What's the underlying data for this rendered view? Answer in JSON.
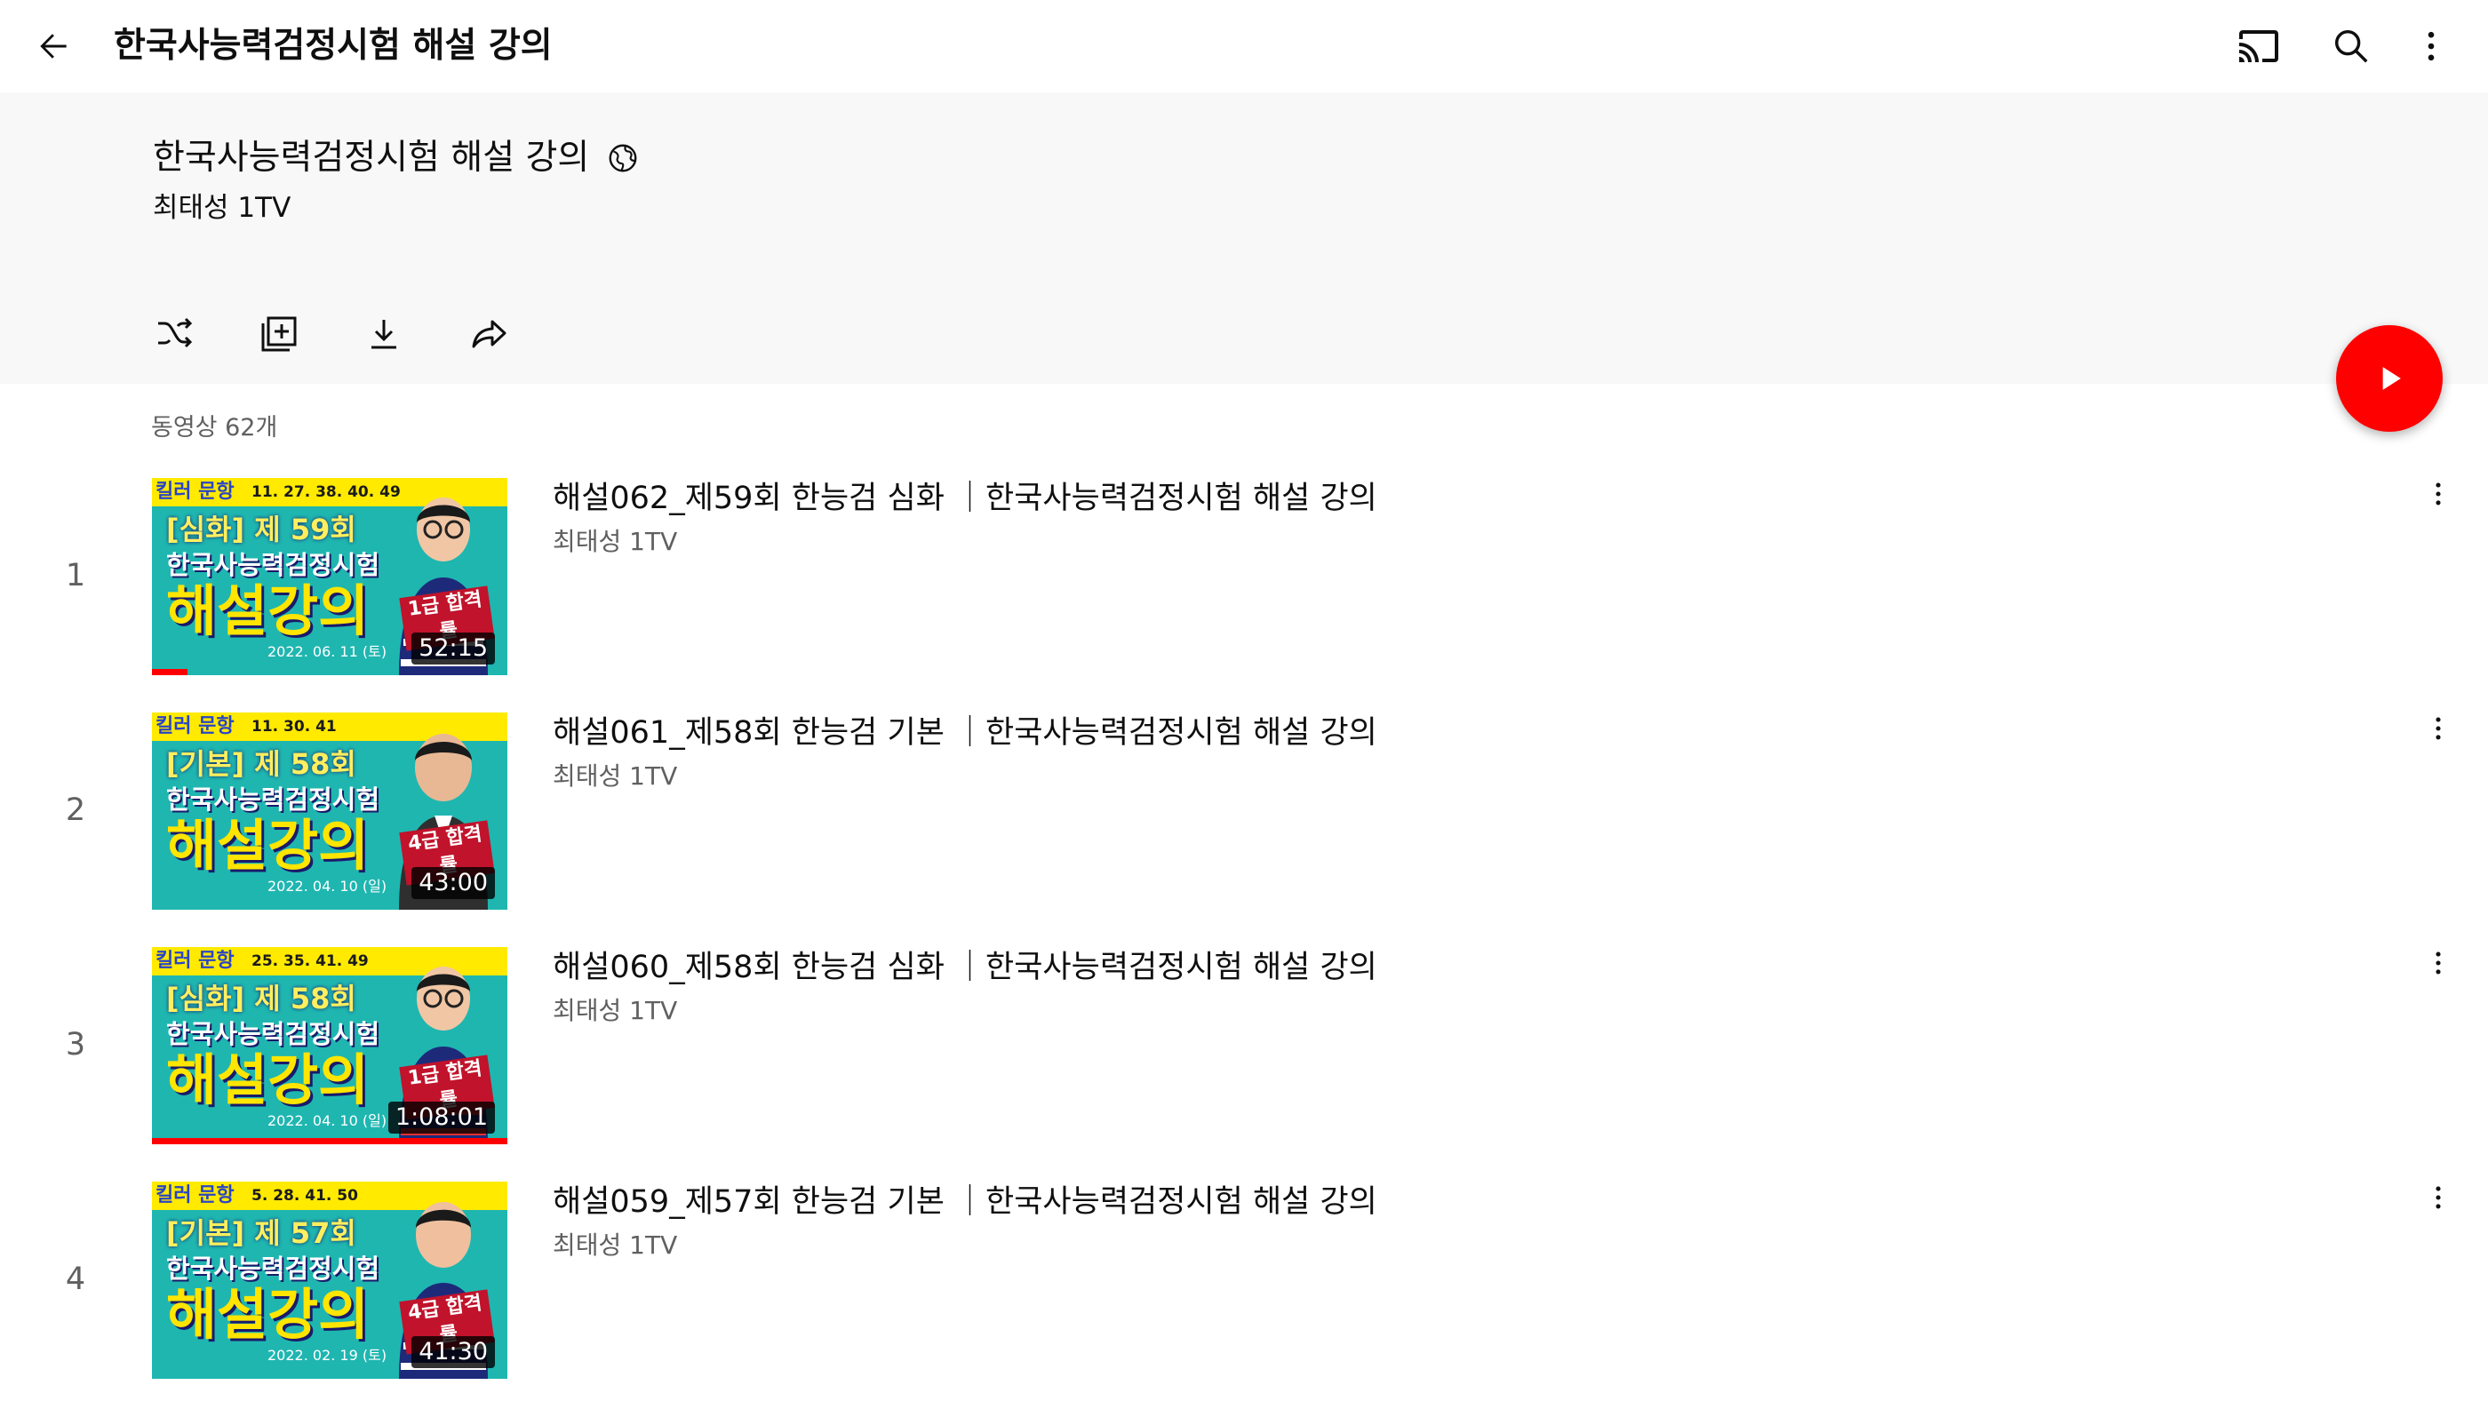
{
  "topbar": {
    "title": "한국사능력검정시험 해설 강의"
  },
  "header": {
    "playlist_title": "한국사능력검정시험 해설 강의",
    "channel": "최태성 1TV"
  },
  "video_count": "동영상 62개",
  "colors": {
    "accent": "#ff0000",
    "header_bg": "#f8f8f8",
    "secondary_text": "#606060"
  },
  "videos": [
    {
      "index": "1",
      "title": "해설062_제59회 한능검 심화 ｜한국사능력검정시험 해설 강의",
      "channel": "최태성 1TV",
      "duration": "52:15",
      "progress": 0.1,
      "thumb": {
        "tag": "킬러 문항",
        "nums": "11. 27. 38. 40. 49",
        "sub": "[심화] 제 59회",
        "line2": "한국사능력검정시험",
        "big": "해설강의",
        "date": "2022. 06. 11 (토)",
        "badge": "1급 합격률"
      }
    },
    {
      "index": "2",
      "title": "해설061_제58회 한능검 기본 ｜한국사능력검정시험 해설 강의",
      "channel": "최태성 1TV",
      "duration": "43:00",
      "progress": 0,
      "thumb": {
        "tag": "킬러 문항",
        "nums": "11. 30. 41",
        "sub": "[기본] 제 58회",
        "line2": "한국사능력검정시험",
        "big": "해설강의",
        "date": "2022. 04. 10 (일)",
        "badge": "4급 합격률"
      }
    },
    {
      "index": "3",
      "title": "해설060_제58회 한능검 심화 ｜한국사능력검정시험 해설 강의",
      "channel": "최태성 1TV",
      "duration": "1:08:01",
      "progress": 1,
      "thumb": {
        "tag": "킬러 문항",
        "nums": "25. 35. 41. 49",
        "sub": "[심화] 제 58회",
        "line2": "한국사능력검정시험",
        "big": "해설강의",
        "date": "2022. 04. 10 (일)",
        "badge": "1급 합격률"
      }
    },
    {
      "index": "4",
      "title": "해설059_제57회 한능검 기본 ｜한국사능력검정시험 해설 강의",
      "channel": "최태성 1TV",
      "duration": "41:30",
      "progress": 0,
      "thumb": {
        "tag": "킬러 문항",
        "nums": "5. 28. 41. 50",
        "sub": "[기본] 제 57회",
        "line2": "한국사능력검정시험",
        "big": "해설강의",
        "date": "2022. 02. 19 (토)",
        "badge": "4급 합격률"
      }
    }
  ]
}
